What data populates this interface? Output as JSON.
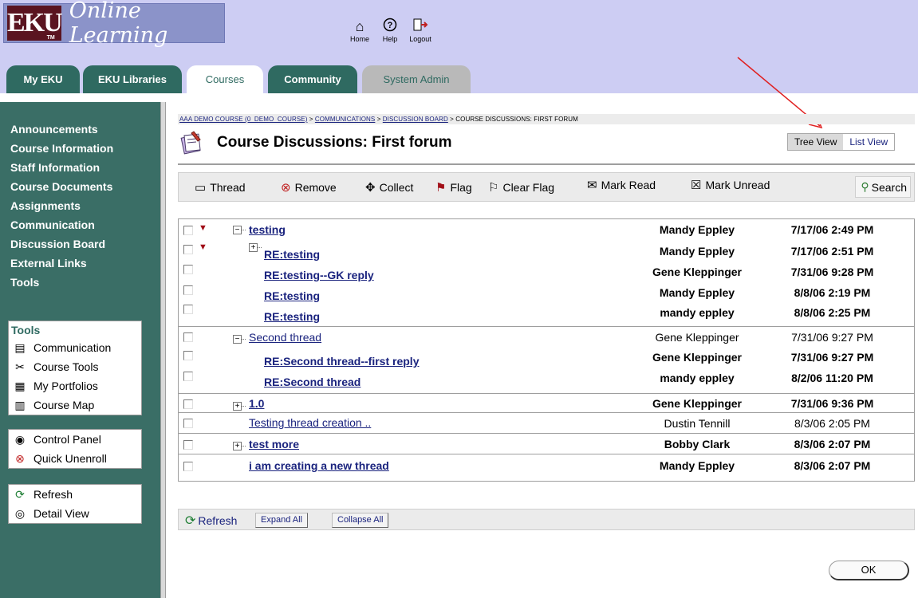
{
  "header": {
    "logo_mark": "EKU",
    "logo_tm": "TM",
    "logo_text": "Online Learning",
    "icons": [
      {
        "name": "home-icon",
        "label": "Home"
      },
      {
        "name": "help-icon",
        "label": "Help"
      },
      {
        "name": "logout-icon",
        "label": "Logout"
      }
    ]
  },
  "tabs": [
    {
      "label": "My EKU",
      "state": "dark"
    },
    {
      "label": "EKU Libraries",
      "state": "dark"
    },
    {
      "label": "Courses",
      "state": "active"
    },
    {
      "label": "Community",
      "state": "dark"
    },
    {
      "label": "System Admin",
      "state": "grey"
    }
  ],
  "sidebar": {
    "nav": [
      "Announcements",
      "Course Information",
      "Staff Information",
      "Course Documents",
      "Assignments",
      "Communication",
      "Discussion Board",
      "External Links",
      "Tools"
    ],
    "tools_panel": {
      "title": "Tools",
      "items": [
        {
          "icon": "communication-icon",
          "label": "Communication"
        },
        {
          "icon": "course-tools-icon",
          "label": "Course Tools"
        },
        {
          "icon": "portfolio-icon",
          "label": "My Portfolios"
        },
        {
          "icon": "course-map-icon",
          "label": "Course Map"
        }
      ]
    },
    "control_panel": [
      {
        "icon": "control-panel-icon",
        "label": "Control Panel"
      },
      {
        "icon": "quick-unenroll-icon",
        "label": "Quick Unenroll"
      }
    ],
    "refresh_panel": [
      {
        "icon": "refresh-icon",
        "label": "Refresh"
      },
      {
        "icon": "detail-view-icon",
        "label": "Detail View"
      }
    ]
  },
  "breadcrumb": {
    "links": [
      "AAA DEMO COURSE (0_DEMO_COURSE)",
      "COMMUNICATIONS",
      "DISCUSSION BOARD"
    ],
    "current": "COURSE DISCUSSIONS: FIRST FORUM",
    "separator": " > "
  },
  "page_title": "Course Discussions: First forum",
  "view_toggle": {
    "tree": "Tree View",
    "list": "List View"
  },
  "toolbar": {
    "thread": "Thread",
    "remove": "Remove",
    "collect": "Collect",
    "flag": "Flag",
    "clear_flag": "Clear Flag",
    "mark_read": "Mark Read",
    "mark_unread": "Mark Unread",
    "search": "Search"
  },
  "threads": [
    {
      "subject": "testing",
      "author": "Mandy Eppley",
      "date": "7/17/06 2:49 PM",
      "bold": true,
      "flag": true,
      "expander": "-"
    },
    {
      "subject": "RE:testing",
      "author": "Mandy Eppley",
      "date": "7/17/06 2:51 PM",
      "bold": true,
      "flag": true,
      "expander": "+"
    },
    {
      "subject": "RE:testing--GK reply",
      "author": "Gene Kleppinger",
      "date": "7/31/06 9:28 PM",
      "bold": true,
      "flag": false,
      "expander": ""
    },
    {
      "subject": "RE:testing",
      "author": "Mandy Eppley",
      "date": "8/8/06 2:19 PM",
      "bold": true,
      "flag": false,
      "expander": ""
    },
    {
      "subject": "RE:testing",
      "author": "mandy eppley",
      "date": "8/8/06 2:25 PM",
      "bold": true,
      "flag": false,
      "expander": ""
    },
    {
      "subject": "Second thread",
      "author": "Gene Kleppinger",
      "date": "7/31/06 9:27 PM",
      "bold": false,
      "flag": false,
      "expander": "-"
    },
    {
      "subject": "RE:Second thread--first reply",
      "author": "Gene Kleppinger",
      "date": "7/31/06 9:27 PM",
      "bold": true,
      "flag": false,
      "expander": ""
    },
    {
      "subject": "RE:Second thread",
      "author": "mandy eppley",
      "date": "8/2/06 11:20 PM",
      "bold": true,
      "flag": false,
      "expander": ""
    },
    {
      "subject": "1.0",
      "author": "Gene Kleppinger",
      "date": "7/31/06 9:36 PM",
      "bold": true,
      "flag": false,
      "expander": "+"
    },
    {
      "subject": "Testing thread creation ..",
      "author": "Dustin Tennill",
      "date": "8/3/06 2:05 PM",
      "bold": false,
      "flag": false,
      "expander": ""
    },
    {
      "subject": "test more",
      "author": "Bobby Clark",
      "date": "8/3/06 2:07 PM",
      "bold": true,
      "flag": false,
      "expander": "+"
    },
    {
      "subject": "i am creating a new thread",
      "author": "Mandy Eppley",
      "date": "8/3/06 2:07 PM",
      "bold": true,
      "flag": false,
      "expander": ""
    }
  ],
  "bottom_bar": {
    "refresh": "Refresh",
    "expand_all": "Expand All",
    "collapse_all": "Collapse All"
  },
  "ok_button": "OK",
  "colors": {
    "header_bg": "#cdcdf3",
    "sidebar_bg": "#3a6e66",
    "tab_dark": "#2f6a61",
    "link": "#1a237e",
    "annotation_arrow": "#e02020"
  }
}
